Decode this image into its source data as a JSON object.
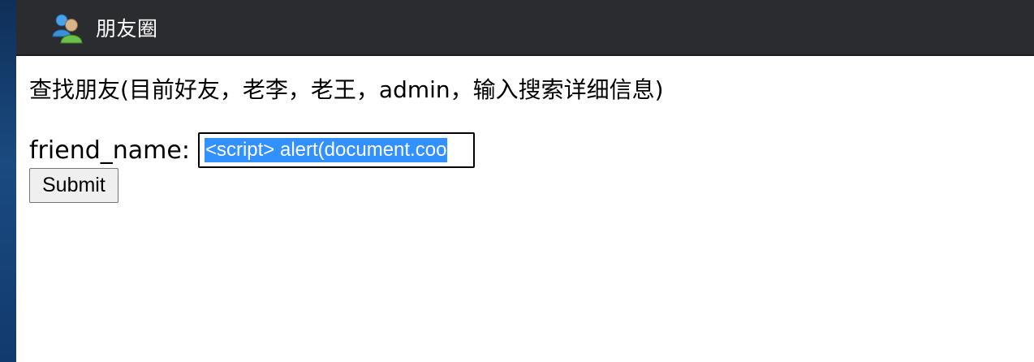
{
  "app": {
    "title": "朋友圈",
    "logo_icon": "users-icon"
  },
  "search": {
    "heading": "查找朋友(目前好友，老李，老王，admin，输入搜索详细信息)",
    "field_label": "friend_name:",
    "input_value": "<script> alert(document.coo",
    "submit_label": "Submit"
  },
  "colors": {
    "titlebar": "#2b2c30",
    "selection": "#3390ff"
  }
}
